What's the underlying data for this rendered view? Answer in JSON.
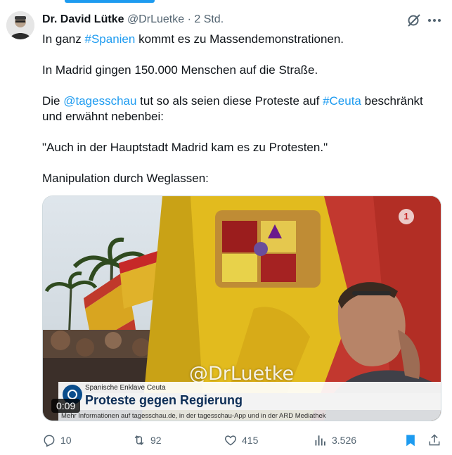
{
  "tweet": {
    "author_name": "Dr. David Lütke",
    "author_handle": "@DrLuetke",
    "separator": "·",
    "time": "2 Std.",
    "lines": {
      "l1_pre": "In ganz ",
      "l1_tag": "#Spanien",
      "l1_post": " kommt es zu Massendemonstrationen.",
      "l2": "In Madrid gingen 150.000 Menschen auf die Straße.",
      "l3_pre": "Die ",
      "l3_mention": "@tagesschau",
      "l3_mid": " tut so als seien diese Proteste auf ",
      "l3_tag": "#Ceuta",
      "l3_post": " beschränkt",
      "l3b": "und erwähnt nebenbei:",
      "l4": "\"Auch in der Hauptstadt Madrid kam es zu Protesten.\"",
      "l5": "Manipulation durch Weglassen:"
    }
  },
  "video": {
    "watermark": "@DrLuetke",
    "ard_logo": "1",
    "kicker": "Spanische Enklave Ceuta",
    "headline": "Proteste gegen Regierung",
    "ticker": "Mehr Informationen auf tagesschau.de, in der tagesschau-App und in der ARD Mediathek",
    "duration": "0:09"
  },
  "actions": {
    "replies": "10",
    "reposts": "92",
    "likes": "415",
    "views": "3.526"
  },
  "colors": {
    "accent": "#1d9bf0",
    "muted": "#536471",
    "text": "#0f1419"
  },
  "icons": [
    "grok-icon",
    "more-icon",
    "reply-icon",
    "repost-icon",
    "like-icon",
    "views-icon",
    "bookmark-icon",
    "share-icon"
  ]
}
